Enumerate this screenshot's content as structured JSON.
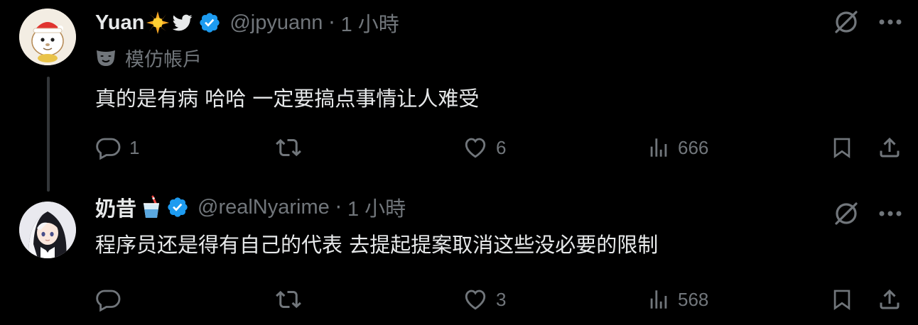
{
  "posts": [
    {
      "name": "Yuan",
      "handle": "@jpyuann",
      "separator": "·",
      "time": "1 小時",
      "label": "模仿帳戶",
      "text": "真的是有病 哈哈 一定要搞点事情让人难受",
      "replies": "1",
      "reposts": "",
      "likes": "6",
      "views": "666",
      "name_emojis": [
        "sun-emoji",
        "bird-emoji"
      ]
    },
    {
      "name": "奶昔",
      "handle": "@realNyarime",
      "separator": "·",
      "time": "1 小時",
      "text": "程序员还是得有自己的代表 去提起提案取消这些没必要的限制",
      "replies": "",
      "reposts": "",
      "likes": "3",
      "views": "568",
      "name_emojis": [
        "drink-emoji"
      ]
    }
  ],
  "colors": {
    "background": "#000000",
    "text": "#e7e9ea",
    "secondary": "#71767b",
    "verified": "#1d9bf0",
    "thread_line": "#333639"
  }
}
